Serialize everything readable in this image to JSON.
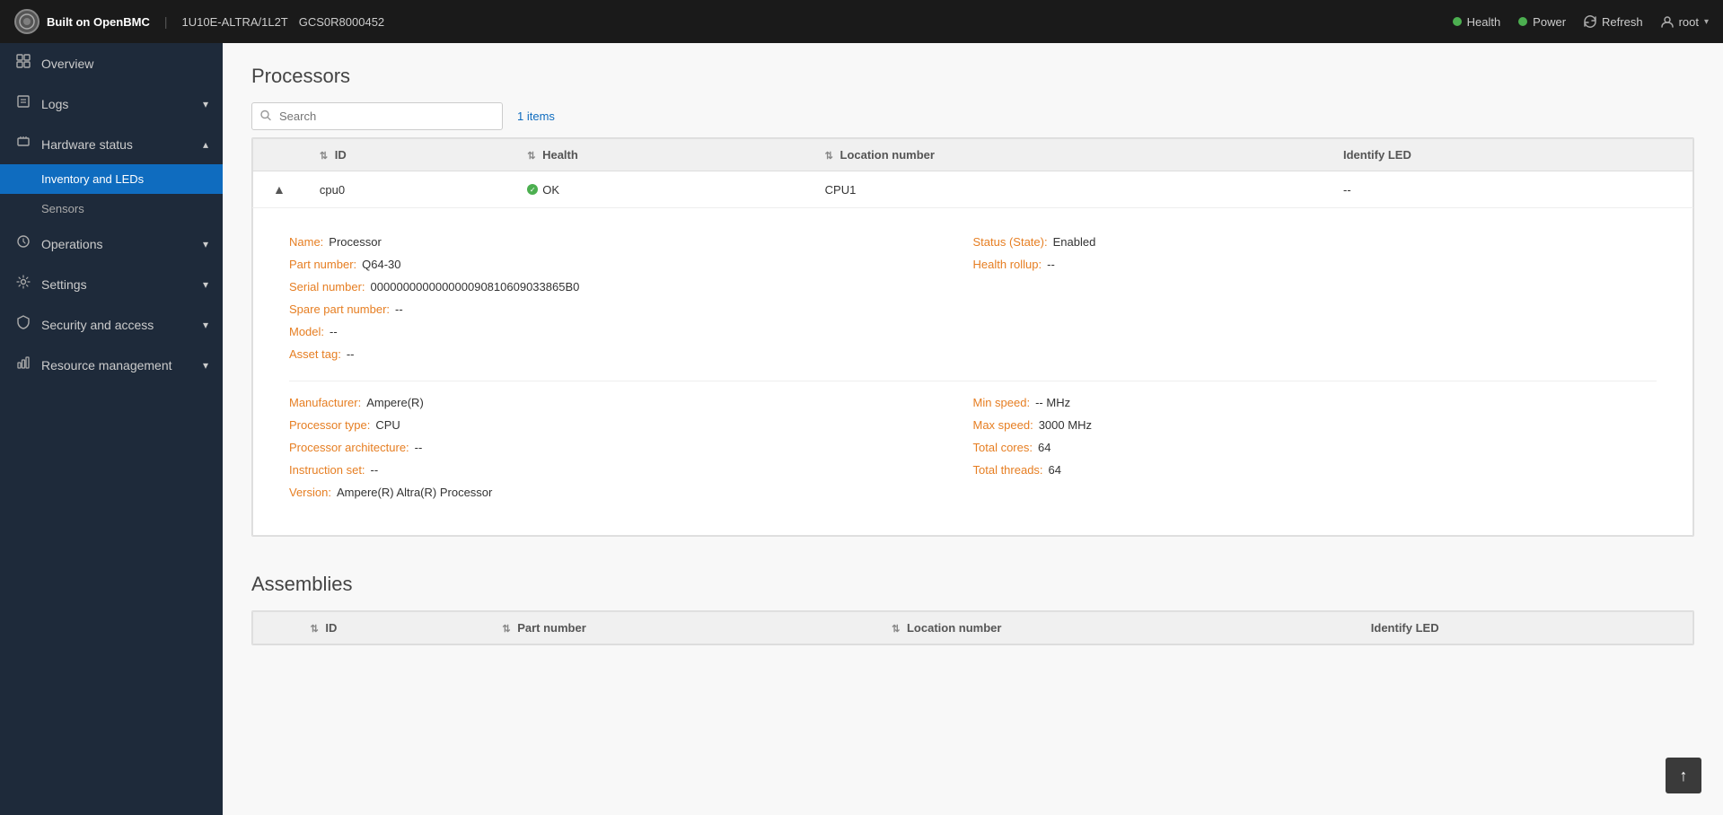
{
  "topbar": {
    "logo_text": "⊙",
    "brand_prefix": "Built on ",
    "brand_name": "OpenBMC",
    "separator": "|",
    "device_model": "1U10E-ALTRA/1L2T",
    "device_serial": "GCS0R8000452",
    "health_label": "Health",
    "power_label": "Power",
    "refresh_label": "Refresh",
    "user_label": "root"
  },
  "sidebar": {
    "items": [
      {
        "id": "overview",
        "label": "Overview",
        "icon": "⊞",
        "has_chevron": false
      },
      {
        "id": "logs",
        "label": "Logs",
        "icon": "☰",
        "has_chevron": true
      },
      {
        "id": "hardware-status",
        "label": "Hardware status",
        "icon": "⬡",
        "has_chevron": true,
        "expanded": true
      },
      {
        "id": "operations",
        "label": "Operations",
        "icon": "⚙",
        "has_chevron": true
      },
      {
        "id": "settings",
        "label": "Settings",
        "icon": "⚙",
        "has_chevron": true
      },
      {
        "id": "security-access",
        "label": "Security and access",
        "icon": "🔒",
        "has_chevron": true
      },
      {
        "id": "resource-management",
        "label": "Resource management",
        "icon": "📊",
        "has_chevron": true
      }
    ],
    "sub_items": [
      {
        "id": "inventory-leds",
        "label": "Inventory and LEDs",
        "active": true
      },
      {
        "id": "sensors",
        "label": "Sensors",
        "active": false
      }
    ]
  },
  "processors": {
    "title": "Processors",
    "search_placeholder": "Search",
    "items_count": "1 items",
    "table": {
      "columns": [
        "ID",
        "Health",
        "Location number",
        "Identify LED"
      ],
      "rows": [
        {
          "id": "cpu0",
          "health": "OK",
          "location_number": "CPU1",
          "identify_led": "--",
          "expanded": true,
          "details": {
            "name_label": "Name:",
            "name_value": "Processor",
            "part_number_label": "Part number:",
            "part_number_value": "Q64-30",
            "serial_number_label": "Serial number:",
            "serial_number_value": "000000000000000090810609033865B0",
            "spare_part_label": "Spare part number:",
            "spare_part_value": "--",
            "model_label": "Model:",
            "model_value": "--",
            "asset_tag_label": "Asset tag:",
            "asset_tag_value": "--",
            "status_label": "Status (State):",
            "status_value": "Enabled",
            "health_rollup_label": "Health rollup:",
            "health_rollup_value": "--",
            "manufacturer_label": "Manufacturer:",
            "manufacturer_value": "Ampere(R)",
            "processor_type_label": "Processor type:",
            "processor_type_value": "CPU",
            "processor_arch_label": "Processor architecture:",
            "processor_arch_value": "--",
            "instruction_set_label": "Instruction set:",
            "instruction_set_value": "--",
            "version_label": "Version:",
            "version_value": "Ampere(R) Altra(R) Processor",
            "min_speed_label": "Min speed:",
            "min_speed_value": "-- MHz",
            "max_speed_label": "Max speed:",
            "max_speed_value": "3000 MHz",
            "total_cores_label": "Total cores:",
            "total_cores_value": "64",
            "total_threads_label": "Total threads:",
            "total_threads_value": "64"
          }
        }
      ]
    }
  },
  "assemblies": {
    "title": "Assemblies",
    "table": {
      "columns": [
        "ID",
        "Part number",
        "Location number",
        "Identify LED"
      ]
    }
  },
  "scroll_top_btn_label": "↑"
}
